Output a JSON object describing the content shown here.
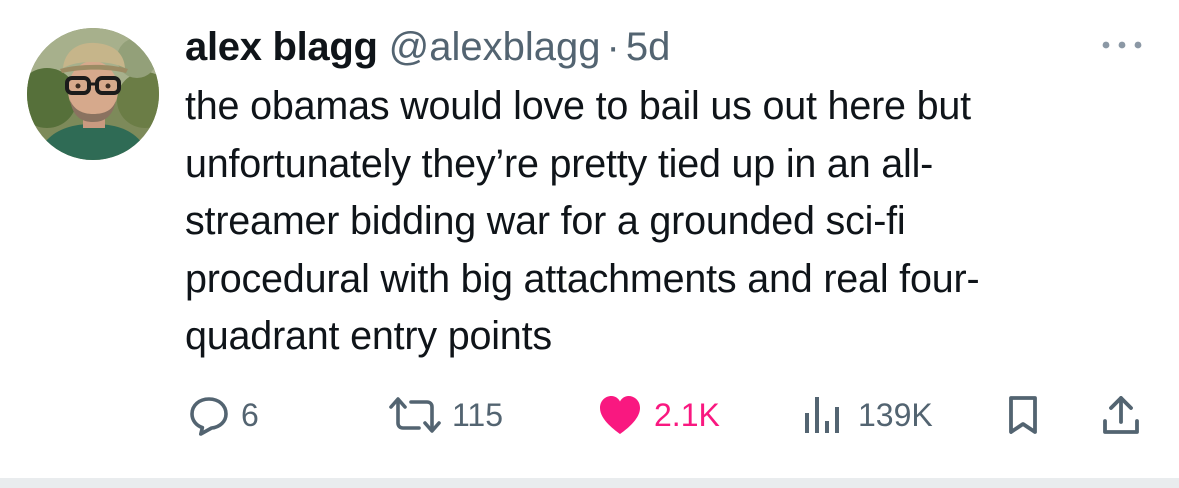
{
  "tweet": {
    "author": {
      "display_name": "alex blagg",
      "handle": "@alexblagg"
    },
    "separator": "·",
    "timestamp": "5d",
    "text": "the obamas would love to bail us out here but unfortunately they’re pretty tied up in an all-streamer bidding war for a grounded sci-fi procedural with big attachments and real four-quadrant entry points",
    "text_lines": [
      "the obamas would love to bail us out here but",
      "unfortunately they’re pretty tied up in an all-",
      "streamer bidding war for a grounded sci-fi",
      "procedural with big attachments and real four-",
      "quadrant entry points"
    ],
    "actions": {
      "reply": {
        "icon": "reply-icon",
        "count": "6"
      },
      "retweet": {
        "icon": "retweet-icon",
        "count": "115"
      },
      "like": {
        "icon": "heart-icon",
        "count": "2.1K",
        "color": "#f91880"
      },
      "views": {
        "icon": "views-chart-icon",
        "count": "139K"
      },
      "bookmark": {
        "icon": "bookmark-icon"
      },
      "share": {
        "icon": "share-icon"
      }
    },
    "more_icon": "more-horizontal-icon"
  },
  "colors": {
    "text_primary": "#0f1419",
    "text_secondary": "#536471",
    "like_pink": "#f91880"
  }
}
